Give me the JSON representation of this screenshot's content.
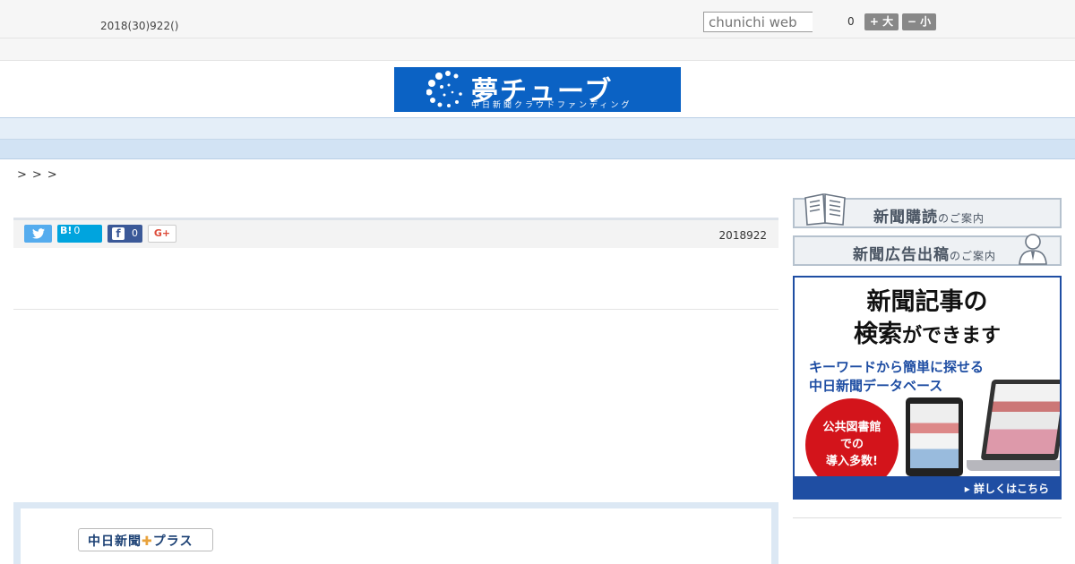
{
  "topbar": {
    "date": "2018(30)922()",
    "search_placeholder": "chunichi web",
    "font_size_count": "0",
    "increase_label": "+ 大",
    "decrease_label": "− 小"
  },
  "banner": {
    "title": "夢チューブ",
    "subtitle": "中日新聞クラウドファンディング"
  },
  "nav": {
    "items": [
      "",
      "",
      "",
      "",
      "",
      "",
      "",
      "",
      ""
    ]
  },
  "breadcrumb": ">>>",
  "article": {
    "share": {
      "twitter_icon": "twitter-icon",
      "hatena_label": "B!",
      "hatena_count": "0",
      "facebook_icon_text": "f",
      "facebook_count": "0",
      "google_plus_label": "G+"
    },
    "date": "2018922"
  },
  "plus": {
    "logo_text": "中日新聞",
    "logo_cross": "✚",
    "logo_suffix": "プラス"
  },
  "sidebar": {
    "subscribe": {
      "main": "新聞購読",
      "suffix": "のご案内"
    },
    "advertise": {
      "main": "新聞広告出稿",
      "suffix": "のご案内"
    },
    "promo": {
      "headline_line1": "新聞記事の",
      "headline_line2_main": "検索",
      "headline_line2_rest": "ができます",
      "lead_line1": "キーワードから簡単に探せる",
      "lead_line2": "中日新聞データベース",
      "badge_line1": "公共図書館",
      "badge_line2": "での",
      "badge_line3": "導入多数!",
      "cta": "▸ 詳しくはこちら"
    }
  },
  "colors": {
    "banner_bg": "#0b62c4",
    "nav_bg": "#e4eef8",
    "promo_accent": "#1f4ea3",
    "badge_red": "#d3141b"
  }
}
